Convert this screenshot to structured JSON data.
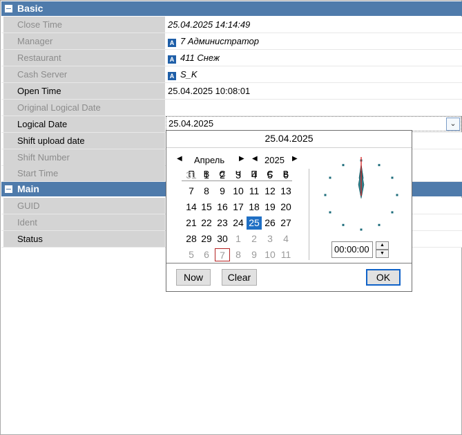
{
  "categories": {
    "basic": "Basic",
    "main": "Main"
  },
  "rows": {
    "close_time": {
      "name": "Close Time",
      "value": "25.04.2025 14:14:49"
    },
    "manager": {
      "name": "Manager",
      "value": "7 Администратор"
    },
    "restaurant": {
      "name": "Restaurant",
      "value": "411 Снеж"
    },
    "cash_server": {
      "name": "Cash Server",
      "value": "S_K"
    },
    "open_time": {
      "name": "Open Time",
      "value": "25.04.2025 10:08:01"
    },
    "original_logical_date": {
      "name": "Original Logical Date",
      "value": ""
    },
    "logical_date": {
      "name": "Logical Date",
      "value": "25.04.2025"
    },
    "shift_upload_date": {
      "name": "Shift upload date",
      "value": ""
    },
    "shift_number": {
      "name": "Shift Number",
      "value": ""
    },
    "start_time": {
      "name": "Start Time",
      "value": ""
    },
    "guid": {
      "name": "GUID",
      "value": ""
    },
    "ident": {
      "name": "Ident",
      "value": ""
    },
    "status": {
      "name": "Status",
      "value": ""
    }
  },
  "object_icon_letter": "A",
  "datepicker": {
    "header_date": "25.04.2025",
    "month": "Апрель",
    "year": "2025",
    "weekdays": [
      "П",
      "В",
      "С",
      "Ч",
      "П",
      "С",
      "В"
    ],
    "weeks": [
      [
        "31",
        "1",
        "2",
        "3",
        "4",
        "5",
        "6"
      ],
      [
        "7",
        "8",
        "9",
        "10",
        "11",
        "12",
        "13"
      ],
      [
        "14",
        "15",
        "16",
        "17",
        "18",
        "19",
        "20"
      ],
      [
        "21",
        "22",
        "23",
        "24",
        "25",
        "26",
        "27"
      ],
      [
        "28",
        "29",
        "30",
        "1",
        "2",
        "3",
        "4"
      ],
      [
        "5",
        "6",
        "7",
        "8",
        "9",
        "10",
        "11"
      ]
    ],
    "selected_day": "25",
    "today_day": "7",
    "time_value": "00:00:00",
    "buttons": {
      "now": "Now",
      "clear": "Clear",
      "ok": "OK"
    },
    "colors": {
      "selected": "#1f6fc4",
      "today_border": "#b32020",
      "clock_dots": "#1b6b7a",
      "hand": "#2f7f8a",
      "second_hand": "#d81e1e"
    }
  },
  "colors": {
    "category_bg": "#4f7bab",
    "name_bg": "#d4d4d4"
  }
}
